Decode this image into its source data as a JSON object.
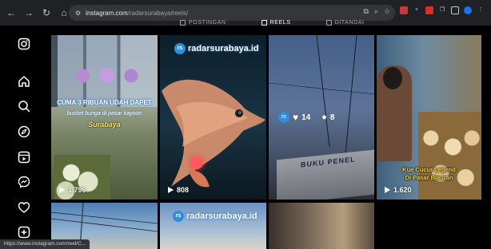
{
  "browser": {
    "url_domain": "instagram.com",
    "url_path": "/radarsurabaya/reels/",
    "nav": [
      "back-icon",
      "forward-icon",
      "reload-icon",
      "home-icon",
      "site-info-icon"
    ]
  },
  "tabs": [
    {
      "label": "POSTINGAN",
      "active": false
    },
    {
      "label": "REELS",
      "active": true
    },
    {
      "label": "DITANDAI",
      "active": false
    }
  ],
  "sidebar_icons": [
    "instagram-icon",
    "home-icon",
    "search-icon",
    "explore-icon",
    "reels-icon",
    "messenger-icon",
    "heart-icon",
    "create-icon"
  ],
  "tiles": [
    {
      "views": "1.796",
      "caption_line1": "CUMA 3 RIBUAN UDAH DAPET",
      "caption_line2": "bucket bunga di pasar kayoon",
      "caption_line3": "Surabaya"
    },
    {
      "views": "808",
      "logo": "radarsurabaya.id"
    },
    {
      "likes": "14",
      "comments": "8",
      "sign": "BUKU PENEL"
    },
    {
      "views": "1.620",
      "caption_line1": "Kue Cucur Legend",
      "caption_line2": "Di Pasar Blauran"
    },
    {
      "logo": "radarsurabaya.id"
    }
  ],
  "status_bar_url": "https://www.instagram.com/reel/C..."
}
